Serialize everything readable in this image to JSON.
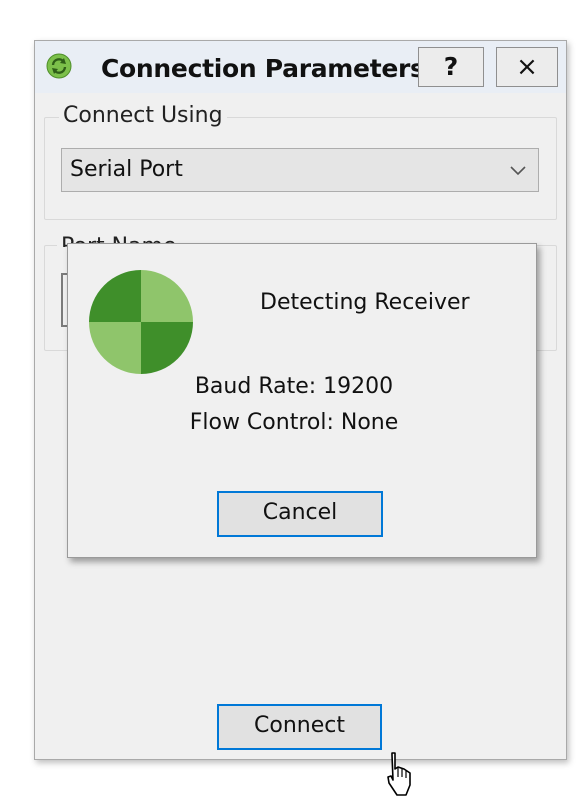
{
  "window": {
    "title": "Connection Parameters",
    "help_label": "?",
    "close_label": "×"
  },
  "connect_using": {
    "label": "Connect Using",
    "selected": "Serial Port"
  },
  "port_name": {
    "label": "Port Name"
  },
  "connect_label": "Connect",
  "detect_dialog": {
    "title": "Detecting Receiver",
    "baud_rate": "Baud Rate: 19200",
    "flow_control": "Flow Control: None",
    "cancel_label": "Cancel"
  },
  "colors": {
    "accent_border": "#0078d7",
    "spinner_dark": "#3f8f2a",
    "spinner_light": "#8fc56b"
  },
  "icons": [
    "refresh-icon",
    "chevron-down-icon",
    "spinner-icon",
    "mouse-cursor-icon"
  ]
}
